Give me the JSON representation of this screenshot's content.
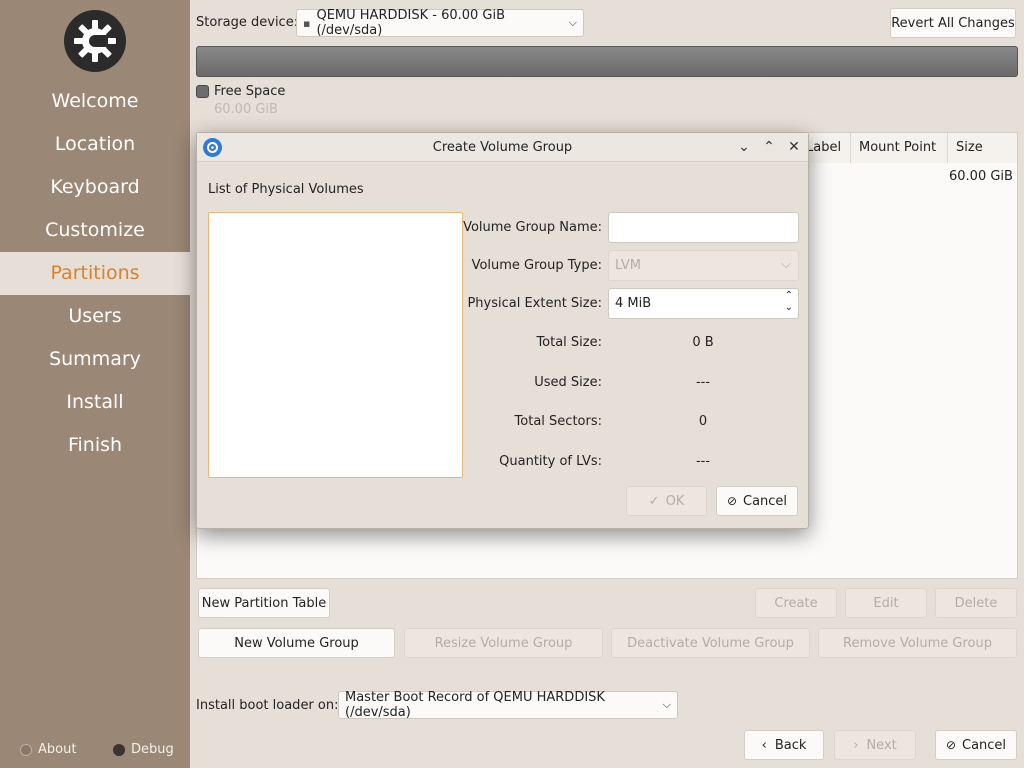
{
  "sidebar": {
    "items": [
      {
        "label": "Welcome"
      },
      {
        "label": "Location"
      },
      {
        "label": "Keyboard"
      },
      {
        "label": "Customize"
      },
      {
        "label": "Partitions"
      },
      {
        "label": "Users"
      },
      {
        "label": "Summary"
      },
      {
        "label": "Install"
      },
      {
        "label": "Finish"
      }
    ],
    "active_index": 4,
    "about_label": "About",
    "debug_label": "Debug"
  },
  "header": {
    "storage_device_label": "Storage device:",
    "storage_device_value": "QEMU HARDDISK - 60.00 GiB (/dev/sda)",
    "revert_label": "Revert All Changes"
  },
  "legend": {
    "name": "Free Space",
    "size": "60.00 GiB"
  },
  "table": {
    "columns": [
      "Label",
      "Mount Point",
      "Size"
    ],
    "row_size": "60.00 GiB"
  },
  "buttons": {
    "new_partition_table": "New Partition Table",
    "create": "Create",
    "edit": "Edit",
    "delete": "Delete",
    "new_volume_group": "New Volume Group",
    "resize_volume_group": "Resize Volume Group",
    "deactivate_volume_group": "Deactivate Volume Group",
    "remove_volume_group": "Remove Volume Group"
  },
  "bootloader": {
    "label": "Install boot loader on:",
    "value": "Master Boot Record of QEMU HARDDISK (/dev/sda)"
  },
  "footer": {
    "back": "Back",
    "next": "Next",
    "cancel": "Cancel"
  },
  "dialog": {
    "title": "Create Volume Group",
    "list_label": "List of Physical Volumes",
    "vg_name_label": "Volume Group Name:",
    "vg_name_value": "",
    "vg_type_label": "Volume Group Type:",
    "vg_type_value": "LVM",
    "pe_size_label": "Physical Extent Size:",
    "pe_size_value": "4 MiB",
    "total_size_label": "Total Size:",
    "total_size_value": "0 B",
    "used_size_label": "Used Size:",
    "used_size_value": "---",
    "total_sectors_label": "Total Sectors:",
    "total_sectors_value": "0",
    "quantity_lvs_label": "Quantity of LVs:",
    "quantity_lvs_value": "---",
    "ok_label": "OK",
    "cancel_label": "Cancel"
  }
}
